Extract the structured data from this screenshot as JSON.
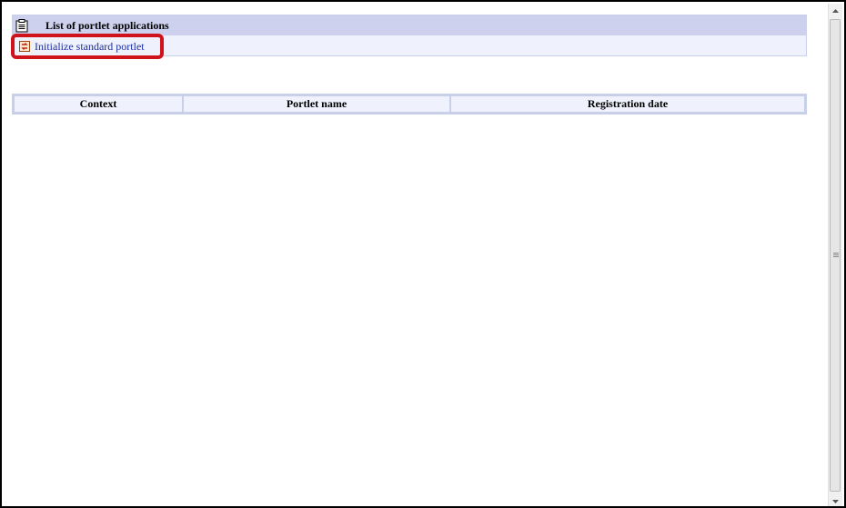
{
  "panel": {
    "title": "List of portlet applications",
    "title_icon": "clipboard-icon",
    "action": {
      "label": "Initialize standard portlet",
      "icon": "initialize-icon"
    }
  },
  "table": {
    "columns": [
      "Context",
      "Portlet name",
      "Registration date"
    ],
    "rows": []
  },
  "colors": {
    "header_bg": "#cdd1ee",
    "body_bg": "#eff1fc",
    "link": "#1c2fa0",
    "highlight": "#d0121b"
  }
}
